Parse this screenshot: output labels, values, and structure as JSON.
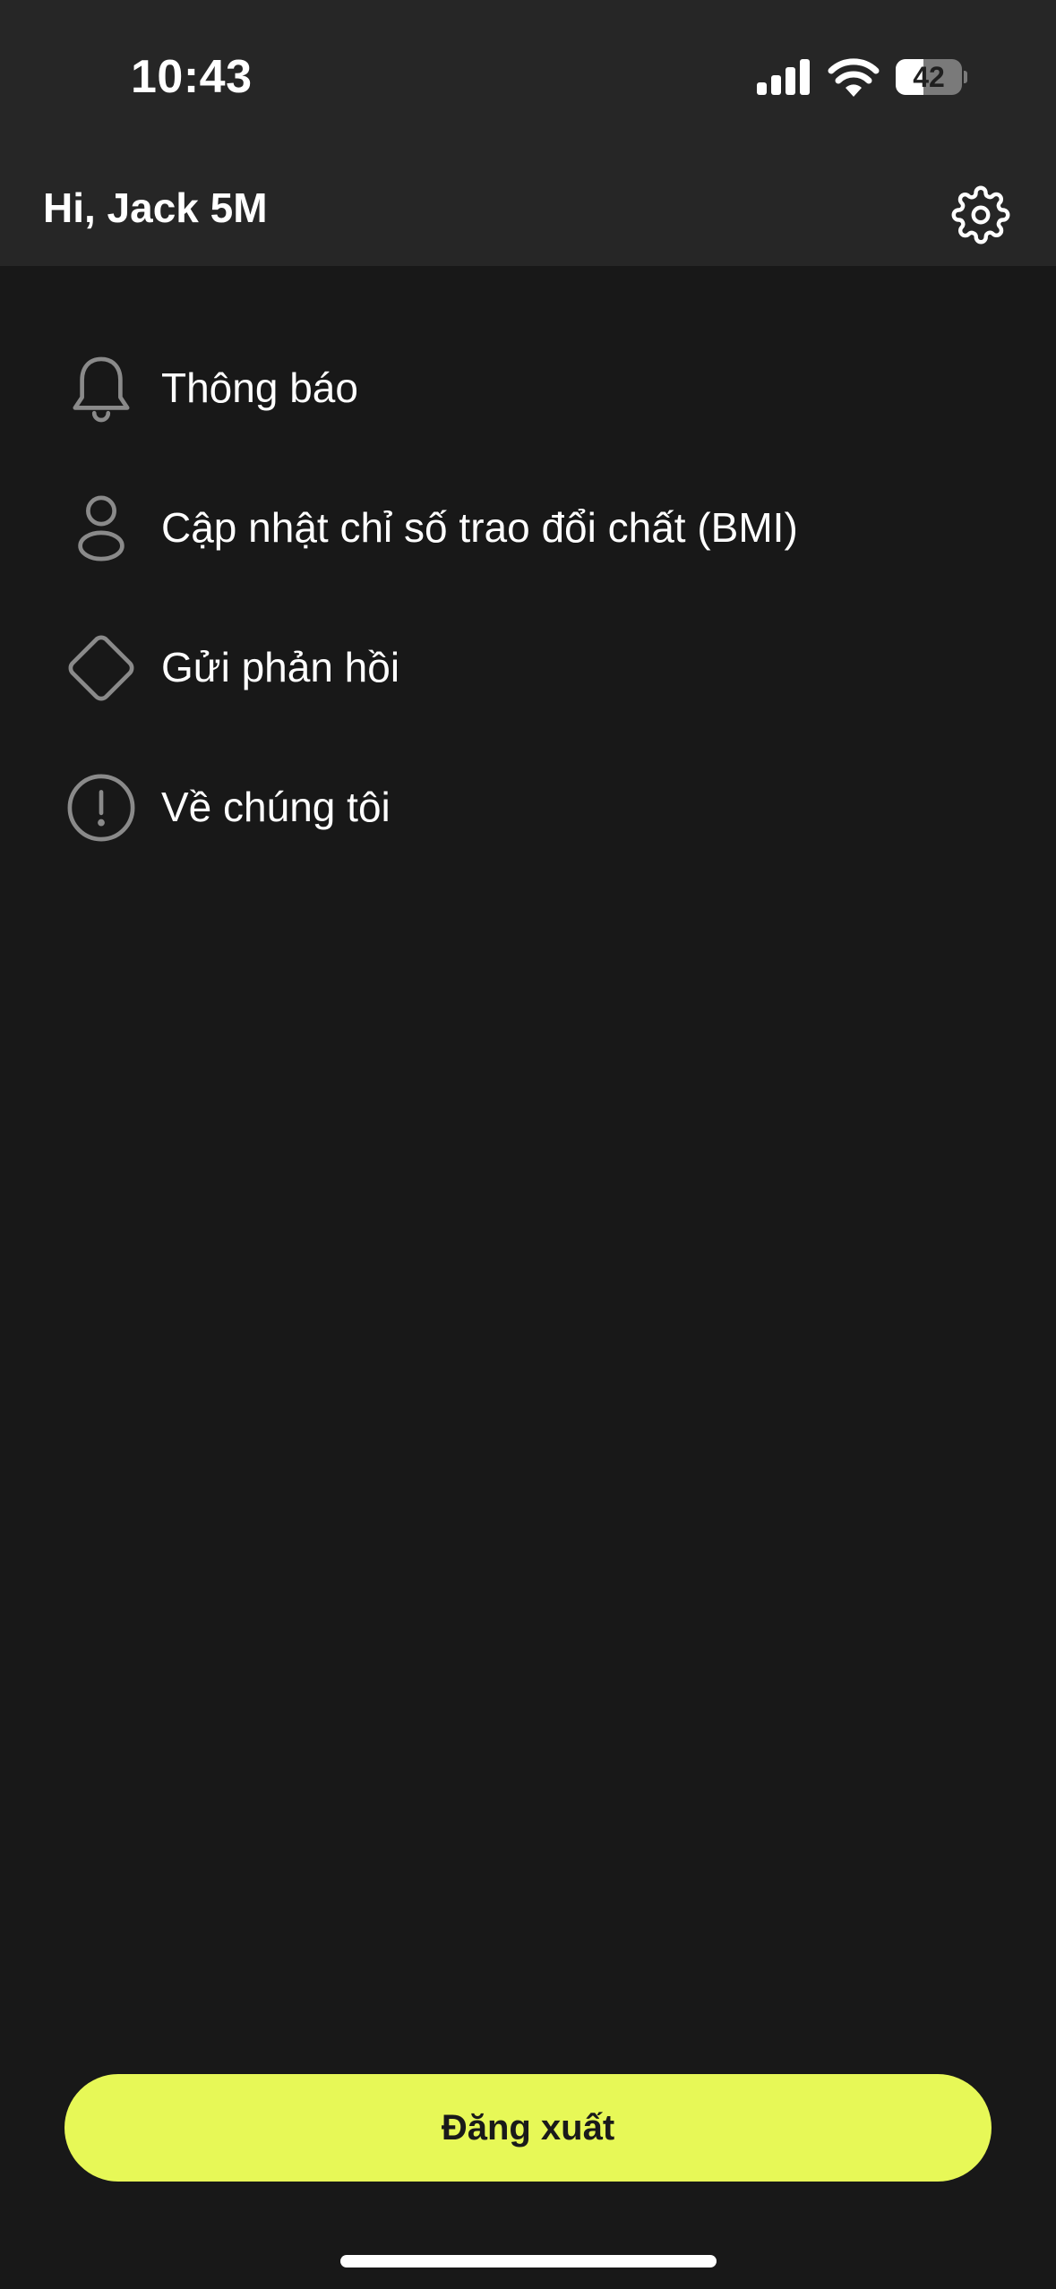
{
  "status_bar": {
    "time": "10:43",
    "battery_level": "42",
    "battery_fraction": 0.42
  },
  "header": {
    "greeting": "Hi, Jack 5M",
    "settings_icon": "gear-icon"
  },
  "menu": {
    "items": [
      {
        "label": "Thông báo",
        "icon": "bell-icon"
      },
      {
        "label": "Cập nhật chỉ số trao đổi chất (BMI)",
        "icon": "user-icon"
      },
      {
        "label": "Gửi phản hồi",
        "icon": "diamond-icon"
      },
      {
        "label": "Về chúng tôi",
        "icon": "info-circle-icon"
      }
    ]
  },
  "logout": {
    "label": "Đăng xuất"
  },
  "colors": {
    "background": "#181818",
    "header_background": "#262626",
    "accent": "#e7f857",
    "icon_stroke": "#8a8a8a"
  }
}
